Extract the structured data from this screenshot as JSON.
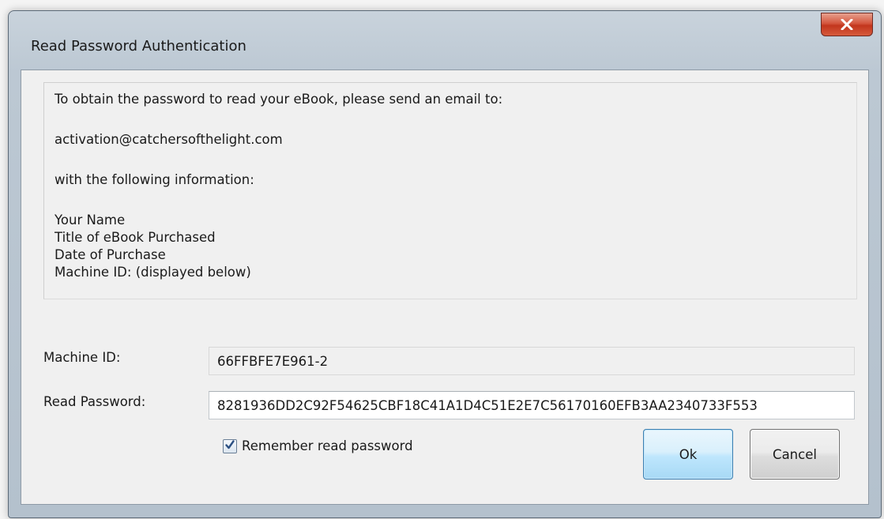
{
  "window": {
    "title": "Read Password Authentication"
  },
  "info": {
    "lines": [
      "To obtain the password to read your eBook, please send an email to:",
      "activation@catchersofthelight.com",
      "with the following information:",
      "Your Name",
      "Title of eBook Purchased",
      "Date of Purchase",
      "Machine ID: (displayed below)"
    ]
  },
  "fields": {
    "machine_id_label": "Machine ID:",
    "machine_id_value": "66FFBFE7E961-2",
    "read_password_label": "Read Password:",
    "read_password_value": "8281936DD2C92F54625CBF18C41A1D4C51E2E7C56170160EFB3AA2340733F553"
  },
  "options": {
    "remember_label": "Remember read password",
    "remember_checked": true
  },
  "buttons": {
    "ok_label": "Ok",
    "cancel_label": "Cancel"
  },
  "icons": {
    "close": "close-icon",
    "check": "checkmark-icon"
  },
  "colors": {
    "close_button": "#c2361d",
    "ok_button_border": "#3c7fb1",
    "window_frame": "#b4c1cd"
  }
}
